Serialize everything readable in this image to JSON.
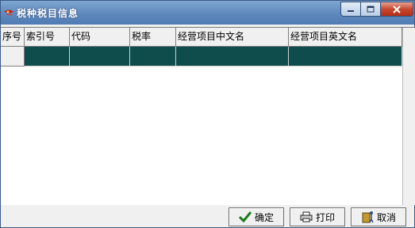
{
  "window": {
    "title": "税种税目信息",
    "icon": "app-icon"
  },
  "grid": {
    "columns": [
      "序号",
      "索引号",
      "代码",
      "税率",
      "经营项目中文名",
      "经营项目英文名"
    ],
    "rows": [
      [
        "",
        "",
        "",
        "",
        "",
        ""
      ]
    ],
    "selected_row_color": "#0f4d4d"
  },
  "buttons": {
    "confirm": "确定",
    "print": "打印",
    "cancel": "取消"
  },
  "colors": {
    "titlebar": "#5f89bd",
    "close_button": "#c7482f"
  }
}
